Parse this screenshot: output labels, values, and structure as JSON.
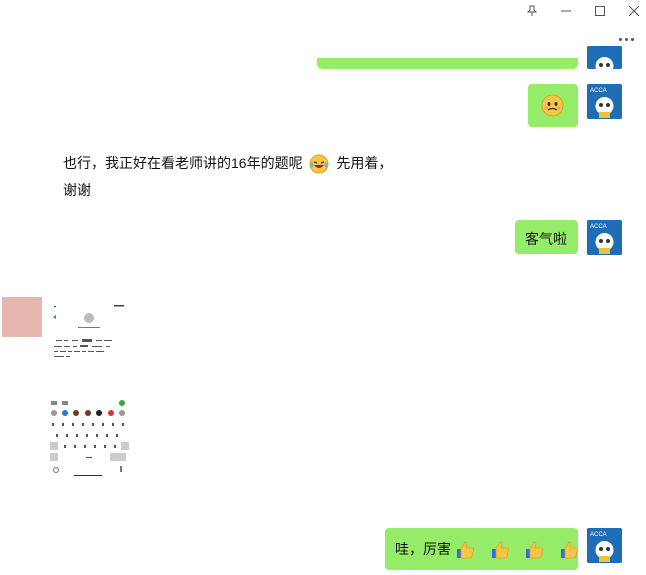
{
  "window": {
    "pin_icon": "pin-icon",
    "minimize_icon": "minimize-icon",
    "maximize_icon": "maximize-icon",
    "close_icon": "close-icon",
    "more_icon": "more-icon"
  },
  "messages": [
    {
      "side": "right",
      "type": "bubble-fragment"
    },
    {
      "side": "right",
      "type": "emoji",
      "emoji": "worried-face"
    },
    {
      "side": "left",
      "type": "text",
      "line1": "也行，我正好在看老师讲的16年的题呢",
      "line1_tail": "先用着，",
      "line2": "谢谢",
      "emoji": "laughing-tears-face"
    },
    {
      "side": "right",
      "type": "text",
      "text": "客气啦"
    },
    {
      "side": "left",
      "type": "image",
      "description_icon": "phone-screenshot"
    },
    {
      "side": "right",
      "type": "text",
      "text": "哇，厉害",
      "emoji": "thumbs-up",
      "emoji_count": 4
    }
  ],
  "avatar": {
    "label": "ACCA",
    "color": "#1f6db6"
  },
  "colors": {
    "green_bubble": "#95ec69",
    "sender_tile": "#e6b7ae"
  }
}
